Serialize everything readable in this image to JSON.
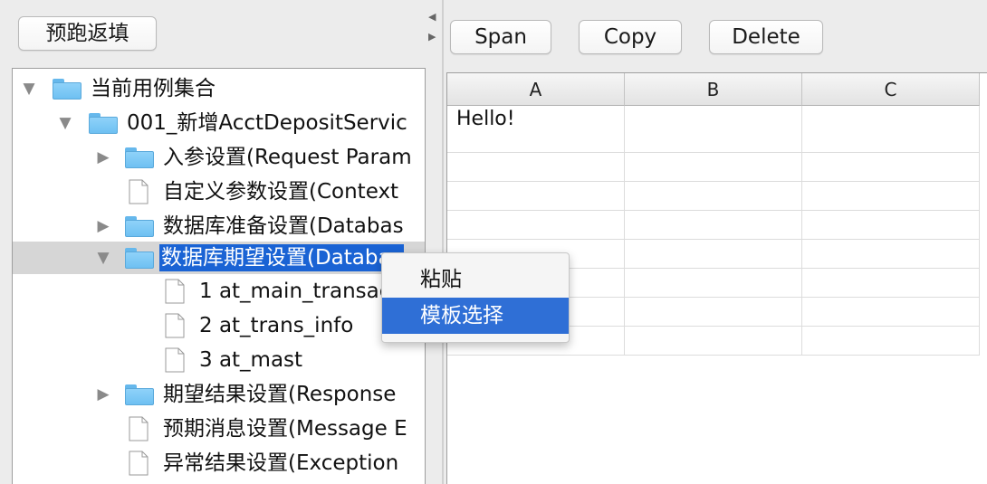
{
  "left_toolbar": {
    "prefill_button": "预跑返填"
  },
  "right_toolbar": {
    "span_button": "Span",
    "copy_button": "Copy",
    "delete_button": "Delete"
  },
  "tree": {
    "items": [
      {
        "label": "当前用例集合",
        "icon": "folder-icon",
        "toggle": "expanded"
      },
      {
        "label": "001_新增AcctDepositServic",
        "icon": "folder-icon",
        "toggle": "expanded"
      },
      {
        "label": "入参设置(Request Param",
        "icon": "folder-icon",
        "toggle": "collapsed"
      },
      {
        "label": "自定义参数设置(Context",
        "icon": "file-icon",
        "toggle": "none"
      },
      {
        "label": "数据库准备设置(Databas",
        "icon": "folder-icon",
        "toggle": "collapsed"
      },
      {
        "label": "数据库期望设置(Databas",
        "icon": "folder-icon",
        "toggle": "expanded",
        "selected": true
      },
      {
        "label": "1 at_main_transaction",
        "icon": "file-icon",
        "toggle": "none"
      },
      {
        "label": "2 at_trans_info",
        "icon": "file-icon",
        "toggle": "none"
      },
      {
        "label": "3 at_mast",
        "icon": "file-icon",
        "toggle": "none"
      },
      {
        "label": "期望结果设置(Response",
        "icon": "folder-icon",
        "toggle": "collapsed"
      },
      {
        "label": "预期消息设置(Message E",
        "icon": "file-icon",
        "toggle": "none"
      },
      {
        "label": "异常结果设置(Exception",
        "icon": "file-icon",
        "toggle": "none"
      }
    ]
  },
  "grid": {
    "columns": [
      "A",
      "B",
      "C"
    ],
    "cells": {
      "A1": "Hello!"
    }
  },
  "context_menu": {
    "items": [
      {
        "label": "粘贴",
        "highlighted": false
      },
      {
        "label": "模板选择",
        "highlighted": true
      }
    ]
  },
  "colors": {
    "selection": "#1a63d4",
    "menu_highlight": "#2f6fd6",
    "folder": "#7cc7f5"
  }
}
